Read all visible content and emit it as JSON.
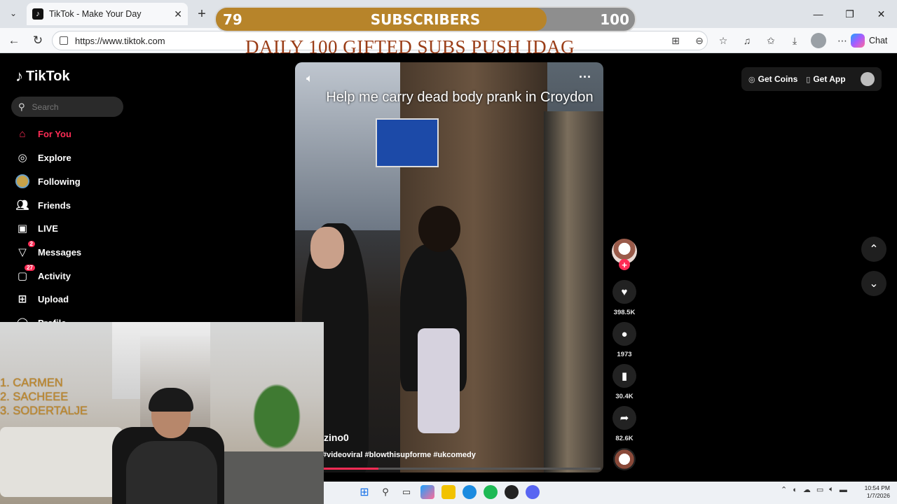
{
  "browser": {
    "tab_title": "TikTok - Make Your Day",
    "url": "https://www.tiktok.com",
    "chat_label": "Chat"
  },
  "overlay": {
    "sub_current": "79",
    "sub_label": "SUBSCRIBERS",
    "sub_goal": "100",
    "sub_progress": 0.79,
    "banner": "DAILY 100  GIFTED SUBS PUSH IDAG"
  },
  "sidebar": {
    "logo": "TikTok",
    "search_placeholder": "Search",
    "items": [
      {
        "label": "For You",
        "icon": "home-icon",
        "active": true
      },
      {
        "label": "Explore",
        "icon": "compass-icon"
      },
      {
        "label": "Following",
        "icon": "following-avatar-icon"
      },
      {
        "label": "Friends",
        "icon": "friends-icon"
      },
      {
        "label": "LIVE",
        "icon": "live-icon"
      },
      {
        "label": "Messages",
        "icon": "messages-icon",
        "badge": "2"
      },
      {
        "label": "Activity",
        "icon": "activity-icon",
        "badge": "27"
      },
      {
        "label": "Upload",
        "icon": "upload-icon"
      },
      {
        "label": "Profile",
        "icon": "profile-icon"
      }
    ]
  },
  "topbar": {
    "get_coins": "Get Coins",
    "get_app": "Get App"
  },
  "video": {
    "caption": "Help me carry dead body prank in Croydon",
    "username": "zino0",
    "tags": "#videoviral #blowthisupforme #ukcomedy",
    "likes": "398.5K",
    "comments": "1973",
    "saves": "30.4K",
    "shares": "82.6K",
    "progress": 0.2
  },
  "stream": {
    "names": [
      "1.  CARMEN",
      "2.  SACHEEE",
      "3.  SODERTALJE"
    ]
  },
  "taskbar": {
    "time": "10:54 PM",
    "date": "1/7/2026"
  },
  "colors": {
    "accent": "#fe2c55",
    "sub_fill": "#b7842a"
  }
}
